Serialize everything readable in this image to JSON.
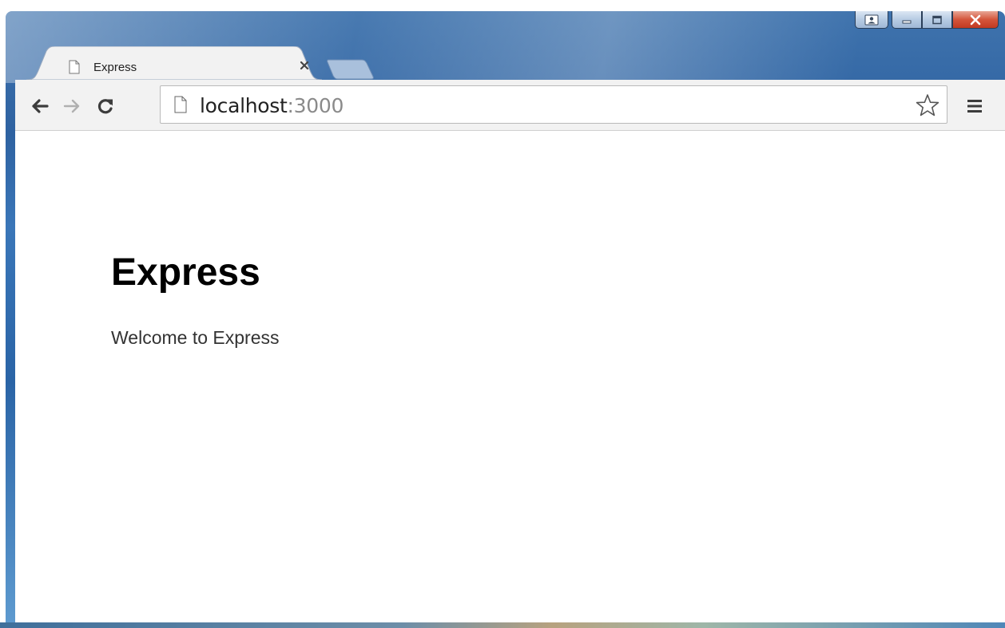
{
  "window": {
    "caption_buttons": {
      "profile_icon": "profile-icon",
      "minimize_icon": "minimize-icon",
      "maximize_icon": "maximize-icon",
      "close_icon": "close-icon"
    }
  },
  "tabs": [
    {
      "title": "Express",
      "favicon": "page-icon",
      "close_glyph": "×",
      "active": true
    }
  ],
  "toolbar": {
    "back_icon": "back-arrow-icon",
    "forward_icon": "forward-arrow-icon",
    "reload_icon": "reload-icon",
    "address": {
      "host": "localhost",
      "port": ":3000",
      "page_icon": "page-icon",
      "bookmark_icon": "star-icon"
    },
    "menu_icon": "hamburger-menu-icon"
  },
  "page": {
    "heading": "Express",
    "text": "Welcome to Express"
  },
  "colors": {
    "frame_blue": "#2e62a1",
    "toolbar_bg": "#f2f2f2",
    "close_red": "#c23a22",
    "port_gray": "#8a8a8a"
  }
}
